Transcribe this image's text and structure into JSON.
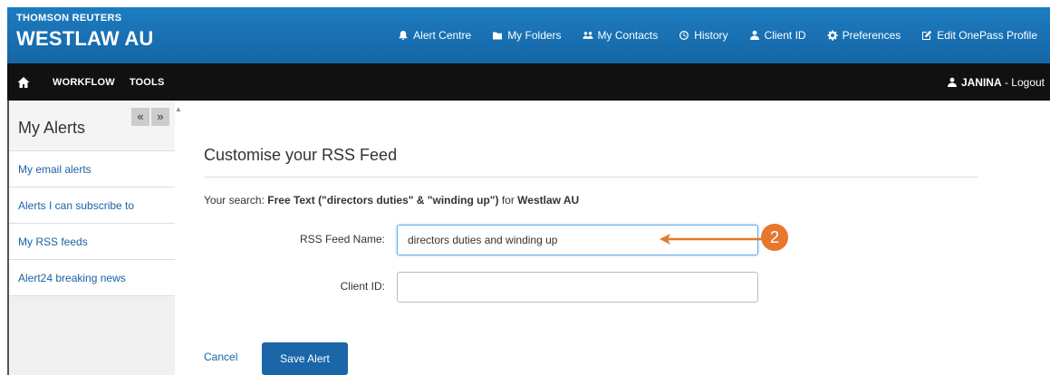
{
  "brand": {
    "top": "THOMSON REUTERS",
    "main": "WESTLAW AU"
  },
  "topnav": [
    {
      "label": "Alert Centre",
      "icon": "bell-icon"
    },
    {
      "label": "My Folders",
      "icon": "folder-icon"
    },
    {
      "label": "My Contacts",
      "icon": "contacts-icon"
    },
    {
      "label": "History",
      "icon": "history-icon"
    },
    {
      "label": "Client ID",
      "icon": "user-icon"
    },
    {
      "label": "Preferences",
      "icon": "gear-icon"
    },
    {
      "label": "Edit OnePass Profile",
      "icon": "edit-icon"
    }
  ],
  "navbar": {
    "items": [
      "WORKFLOW",
      "TOOLS"
    ],
    "user": "JANINA",
    "separator": " - ",
    "logout": "Logout"
  },
  "sidebar": {
    "title": "My Alerts",
    "collapse_left": "«",
    "collapse_right": "»",
    "items": [
      {
        "label": "My email alerts"
      },
      {
        "label": "Alerts I can subscribe to"
      },
      {
        "label": "My RSS feeds"
      },
      {
        "label": "Alert24 breaking news"
      }
    ]
  },
  "main": {
    "title": "Customise your RSS Feed",
    "search_prefix": "Your search: ",
    "search_query": "Free Text (\"directors duties\" & \"winding up\")",
    "search_for": " for ",
    "search_db": "Westlaw AU",
    "feed_name_label": "RSS Feed Name:",
    "feed_name_value": "directors duties and winding up",
    "client_id_label": "Client ID:",
    "client_id_value": "",
    "cancel_label": "Cancel",
    "save_label": "Save Alert"
  },
  "annotation": {
    "number": "2"
  },
  "colors": {
    "header_blue": "#1d7cc0",
    "nav_black": "#111111",
    "link_blue": "#1a62a7",
    "button_blue": "#1a66a9",
    "annotation_orange": "#e8772e"
  }
}
